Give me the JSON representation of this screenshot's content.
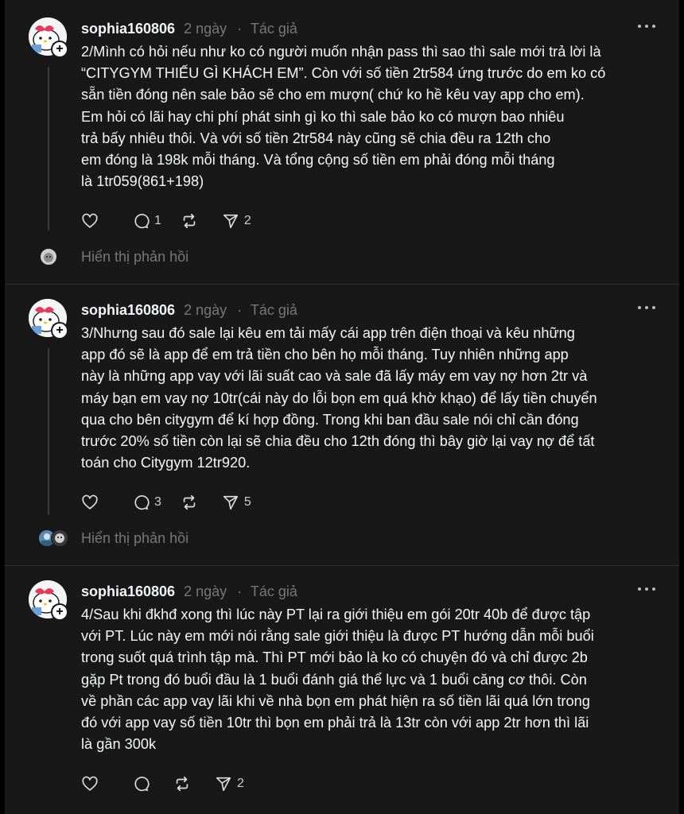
{
  "posts": [
    {
      "username": "sophia160806",
      "time": "2 ngày",
      "tag": "Tác giả",
      "body": "2/Mình có hỏi nếu như ko có người muốn nhận pass thì sao thì sale mới trả lời là\n“CITYGYM THIẾU GÌ KHÁCH EM”. Còn với số tiền 2tr584 ứng trước do em ko có\nsẵn tiền đóng nên sale bảo sẽ cho em mượn( chứ ko hề kêu vay app cho em).\nEm hỏi có lãi hay chi phí phát sinh gì ko thì sale bảo ko có mượn bao nhiêu\ntrả bấy nhiêu thôi. Và với số tiền 2tr584 này cũng sẽ chia đều ra 12th cho\nem đóng là 198k mỗi tháng. Và tổng cộng số tiền em phải đóng mỗi tháng\nlà 1tr059(861+198)",
      "comments": "1",
      "reposts": "",
      "shares": "2",
      "replies_label": "Hiển thị phản hồi"
    },
    {
      "username": "sophia160806",
      "time": "2 ngày",
      "tag": "Tác giả",
      "body": "3/Nhưng sau đó sale lại kêu em tải mấy cái app trên điện thoại và kêu những\napp đó sẽ là app để em trả tiền cho bên họ mỗi tháng. Tuy nhiên những app\nnày là những app vay với lãi suất cao và sale đã lấy máy em vay nợ hơn 2tr và\nmáy bạn em vay nợ 10tr(cái này do lỗi bọn em quá khờ khạo) để lấy tiền chuyển\nqua cho bên citygym để kí hợp đồng. Trong khi ban đầu sale nói chỉ cần đóng\ntrước 20% số tiền còn lại sẽ chia đều cho 12th đóng thì bây giờ lại vay nợ để tất\ntoán cho Citygym 12tr920.",
      "comments": "3",
      "reposts": "",
      "shares": "5",
      "replies_label": "Hiển thị phản hồi"
    },
    {
      "username": "sophia160806",
      "time": "2 ngày",
      "tag": "Tác giả",
      "body": "4/Sau khi đkhđ xong thì lúc này PT lại ra giới thiệu em gói 20tr 40b để được tập\nvới PT. Lúc này em mới nói rằng sale giới thiệu là được PT hướng dẫn mỗi buổi\ntrong suốt quá trình tập mà. Thì PT mới bảo là ko có chuyện đó và chỉ được 2b\ngặp Pt trong đó buổi đầu là 1 buổi đánh giá thể lực và 1 buổi căng cơ thôi. Còn\nvề phần các app vay lãi khi về nhà bọn em phát hiện ra số tiền lãi quá lớn trong\nđó với app vay số tiền 10tr thì bọn em phải trả là 13tr còn với app 2tr hơn thì lãi\nlà gần 300k",
      "comments": "",
      "reposts": "",
      "shares": "2",
      "replies_label": ""
    }
  ],
  "icons": {
    "like": "heart-icon",
    "comment": "comment-icon",
    "repost": "repost-icon",
    "share": "share-icon",
    "more": "more-icon"
  }
}
